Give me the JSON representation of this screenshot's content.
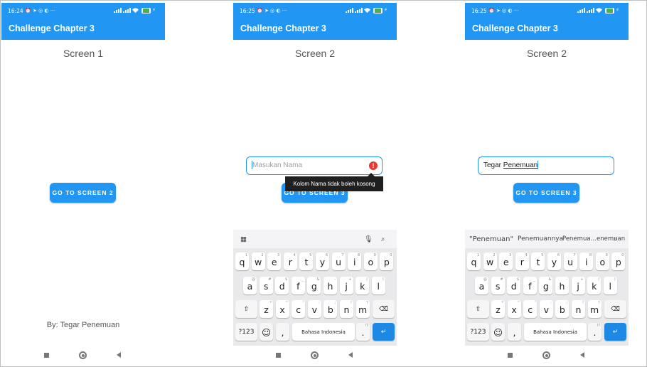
{
  "app_title": "Challenge Chapter 3",
  "status_times": [
    "16:24",
    "16:25",
    "16:25"
  ],
  "screen1": {
    "title": "Screen 1",
    "button": "GO TO SCREEN 2",
    "author": "By: Tegar Penemuan"
  },
  "screen2_error": {
    "title": "Screen 2",
    "input_placeholder": "Masukan Nama",
    "error_message": "Kolom Nama tidak boleh kosong",
    "button": "GO TO SCREEN 3"
  },
  "screen2_filled": {
    "title": "Screen 2",
    "input_prefix": "Tegar ",
    "input_word": "Penemuan",
    "button": "GO TO SCREEN 3",
    "suggestions": [
      "\"Penemuan\"",
      "Penemuannya",
      "Penemua…enemuan"
    ]
  },
  "keyboard": {
    "row1": [
      "q",
      "w",
      "e",
      "r",
      "t",
      "y",
      "u",
      "i",
      "o",
      "p"
    ],
    "row1_hints": [
      "1",
      "2",
      "3",
      "4",
      "5",
      "6",
      "7",
      "8",
      "9",
      "0"
    ],
    "row2": [
      "a",
      "s",
      "d",
      "f",
      "g",
      "h",
      "j",
      "k",
      "l"
    ],
    "row2_hints": [
      "@",
      "#",
      "$",
      "_",
      "&",
      "-",
      "+",
      "(",
      ")"
    ],
    "row3": [
      "z",
      "x",
      "c",
      "v",
      "b",
      "n",
      "m"
    ],
    "row3_hints": [
      "*",
      "\"",
      "'",
      ":",
      ";",
      "!",
      "?"
    ],
    "symbols_label": "?123",
    "comma": ",",
    "space_label": "Bahasa Indonesia",
    "period": ".",
    "period_hint": "!?"
  },
  "colors": {
    "primary": "#2196f3",
    "error": "#e53935",
    "tooltip": "#1f1f1f"
  }
}
